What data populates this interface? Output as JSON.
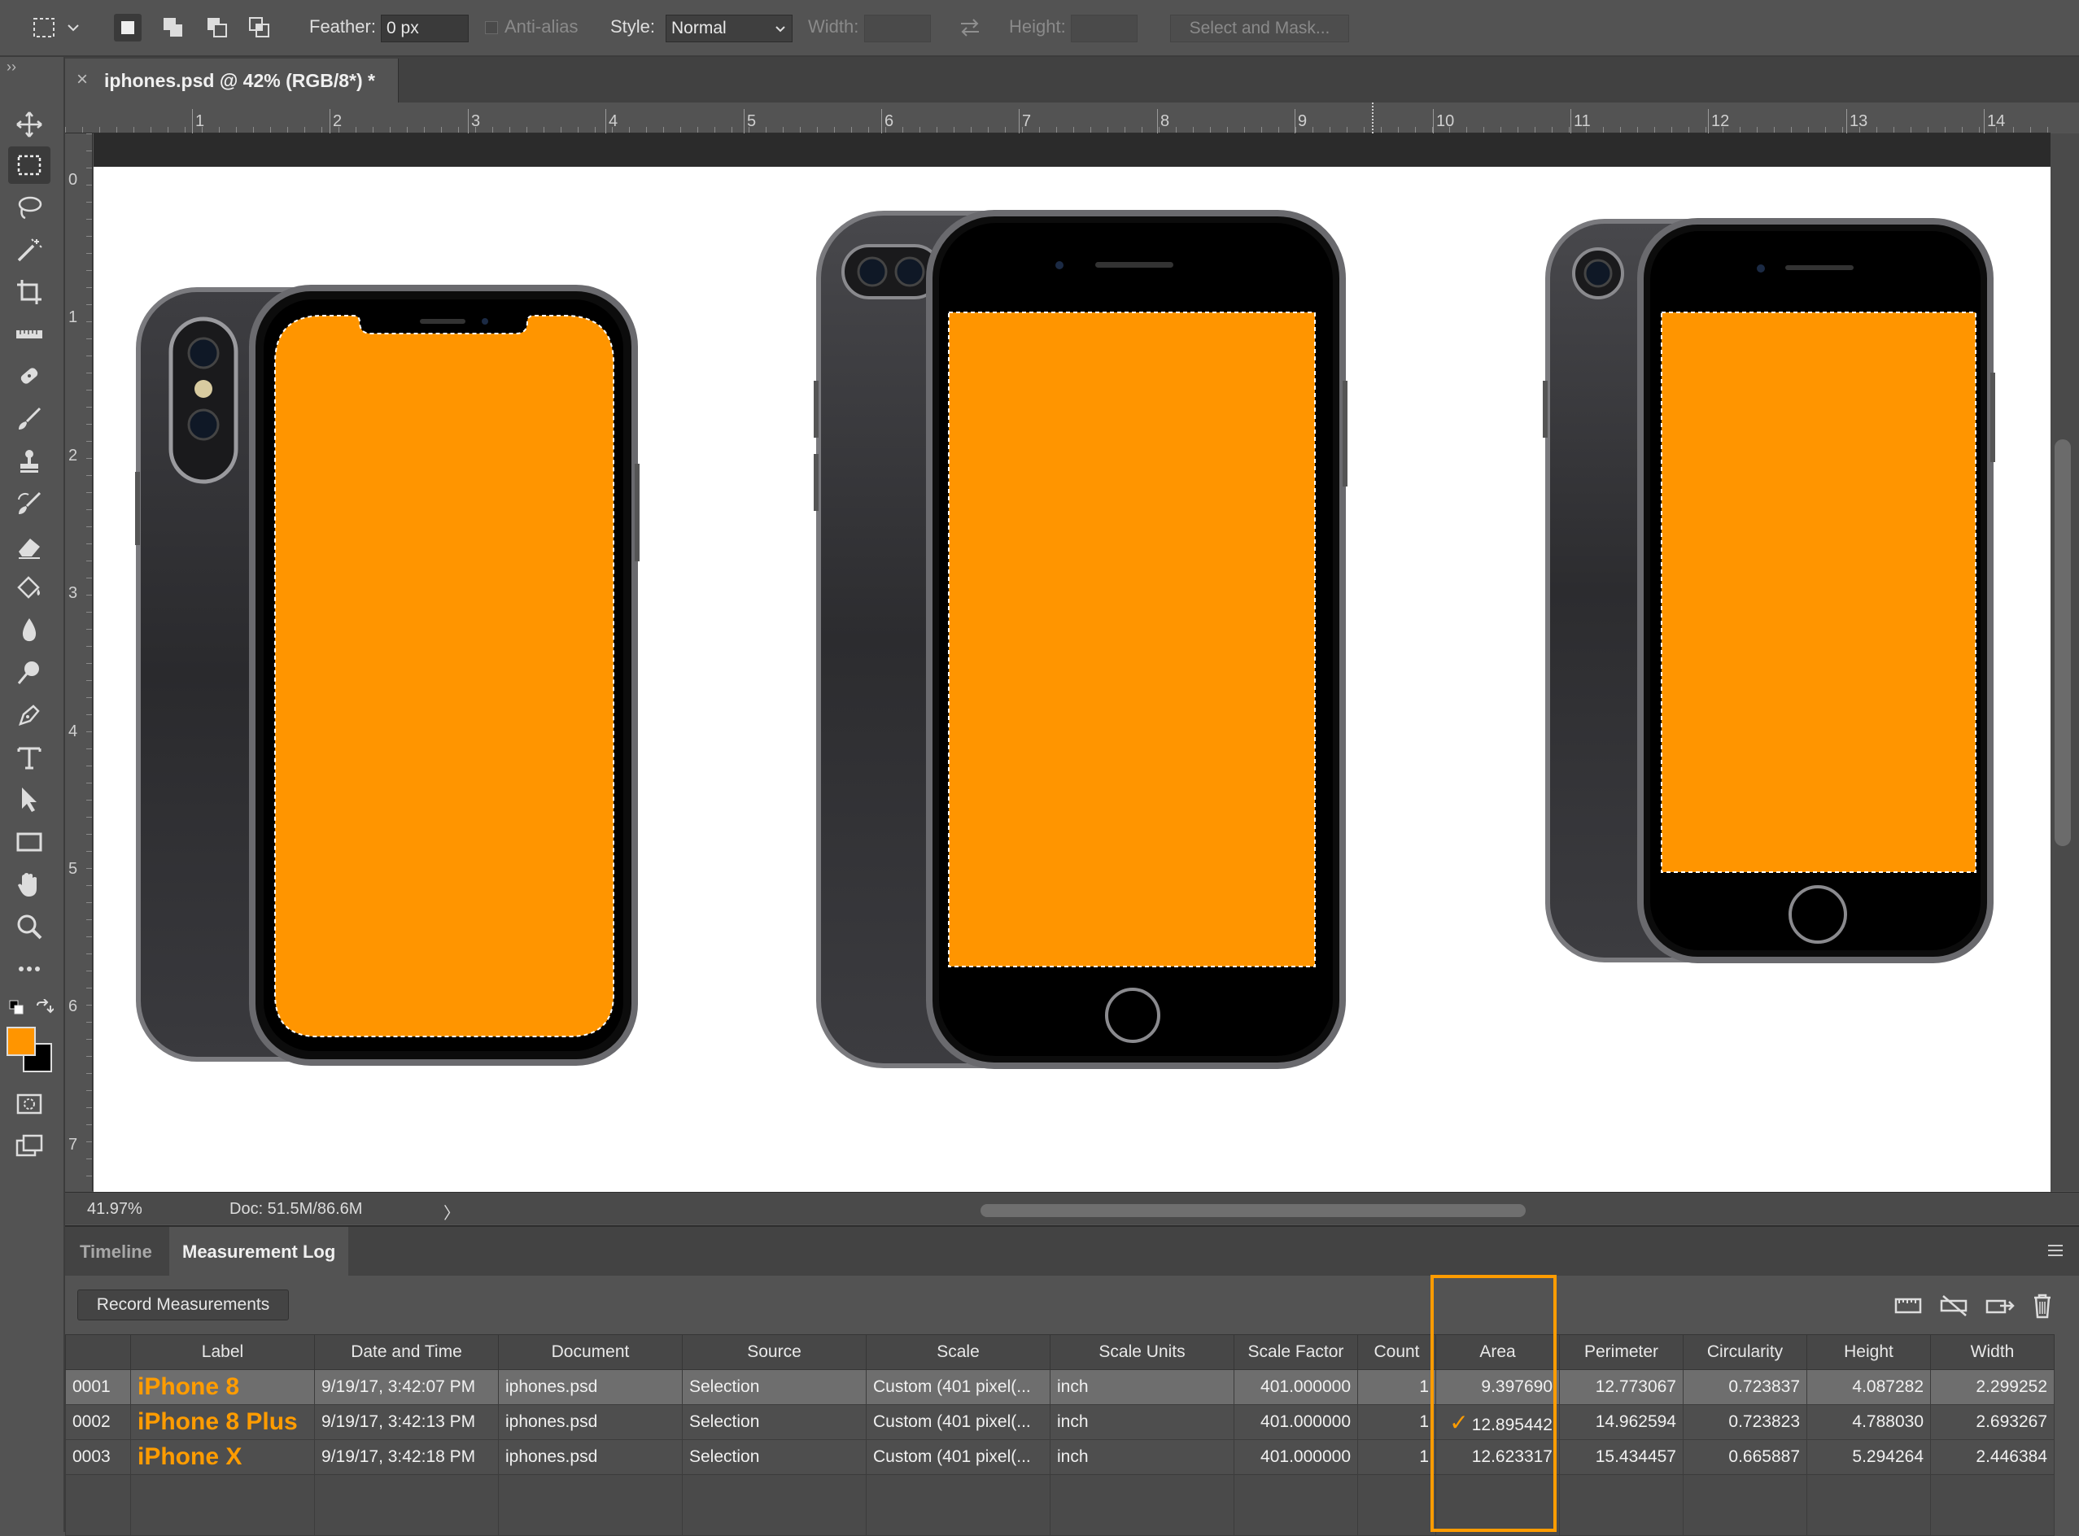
{
  "options_bar": {
    "feather_label": "Feather:",
    "feather_value": "0 px",
    "anti_alias_label": "Anti-alias",
    "style_label": "Style:",
    "style_value": "Normal",
    "width_label": "Width:",
    "height_label": "Height:",
    "select_mask_label": "Select and Mask..."
  },
  "document_tab": {
    "close_glyph": "×",
    "title": "iphones.psd @ 42% (RGB/8*) *"
  },
  "ruler_h": [
    "1",
    "2",
    "3",
    "4",
    "5",
    "6",
    "7",
    "8",
    "9",
    "10",
    "11",
    "12",
    "13",
    "14"
  ],
  "ruler_v": [
    "0",
    "1",
    "2",
    "3",
    "4",
    "5",
    "6",
    "7"
  ],
  "status_bar": {
    "zoom": "41.97%",
    "doc": "Doc: 51.5M/86.6M",
    "arrow": "〉"
  },
  "panel": {
    "tabs": [
      "Timeline",
      "Measurement Log"
    ],
    "active_tab": "Measurement Log",
    "record_button": "Record Measurements",
    "columns": [
      "",
      "Label",
      "Date and Time",
      "Document",
      "Source",
      "Scale",
      "Scale Units",
      "Scale Factor",
      "Count",
      "Area",
      "Perimeter",
      "Circularity",
      "Height",
      "Width"
    ],
    "rows": [
      {
        "id": "0001",
        "label": "iPhone 8",
        "datetime": "9/19/17, 3:42:07 PM",
        "document": "iphones.psd",
        "source": "Selection",
        "scale": "Custom (401 pixel(...",
        "scale_units": "inch",
        "scale_factor": "401.000000",
        "count": "1",
        "area": "9.397690",
        "perimeter": "12.773067",
        "circularity": "0.723837",
        "height": "4.087282",
        "width": "2.299252"
      },
      {
        "id": "0002",
        "label": "iPhone 8 Plus",
        "datetime": "9/19/17, 3:42:13 PM",
        "document": "iphones.psd",
        "source": "Selection",
        "scale": "Custom (401 pixel(...",
        "scale_units": "inch",
        "scale_factor": "401.000000",
        "count": "1",
        "area": "12.895442",
        "perimeter": "14.962594",
        "circularity": "0.723823",
        "height": "4.788030",
        "width": "2.693267"
      },
      {
        "id": "0003",
        "label": "iPhone X",
        "datetime": "9/19/17, 3:42:18 PM",
        "document": "iphones.psd",
        "source": "Selection",
        "scale": "Custom (401 pixel(...",
        "scale_units": "inch",
        "scale_factor": "401.000000",
        "count": "1",
        "area": "12.623317",
        "perimeter": "15.434457",
        "circularity": "0.665887",
        "height": "5.294264",
        "width": "2.446384"
      }
    ],
    "checkmark": "✓"
  },
  "colors": {
    "accent": "#ff9c00",
    "foreground_color": "#ff9500",
    "background_color": "#000000",
    "screen_fill": "#ff9500"
  }
}
